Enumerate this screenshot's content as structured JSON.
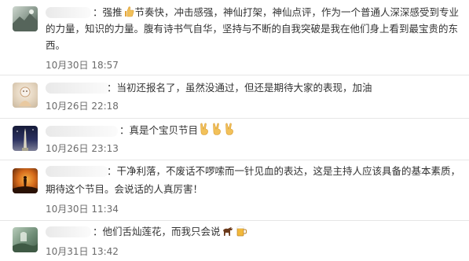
{
  "comments": [
    {
      "username_sep": "：",
      "lines": [
        "强推",
        "节奏快，冲击感强，神仙打架，神仙点评，作为一个普通人深深感受到专业",
        "的力量，知识的力量。腹有诗书气自华，坚持与不断的自我突破是我在他们身上看到最宝贵的东",
        "西。"
      ],
      "time": "10月30日 18:57",
      "avatar_icon": "mountain-landscape-avatar"
    },
    {
      "username_sep": "：",
      "lines": [
        "当初还报名了，虽然没通过，但还是期待大家的表现，加油"
      ],
      "time": "10月26日 22:18",
      "avatar_icon": "cartoon-figure-avatar"
    },
    {
      "username_sep": "：",
      "lines": [
        "真是个宝贝节目"
      ],
      "time": "10月26日 23:13",
      "avatar_icon": "night-tower-avatar"
    },
    {
      "username_sep": "：",
      "lines": [
        "干净利落，不废话不啰嗦而一针见血的表达，这是主持人应该具备的基本素质，",
        "期待这个节目。会说话的人真厉害！"
      ],
      "time": "10月30日 11:34",
      "avatar_icon": "sunset-silhouette-avatar"
    },
    {
      "username_sep": "：",
      "lines": [
        "他们舌灿莲花，而我只会说"
      ],
      "time": "10月31日 13:42",
      "avatar_icon": "green-scene-avatar"
    }
  ],
  "colors": {
    "text": "#333333",
    "time": "#6b6b6b",
    "divider": "#e6e6e6"
  }
}
